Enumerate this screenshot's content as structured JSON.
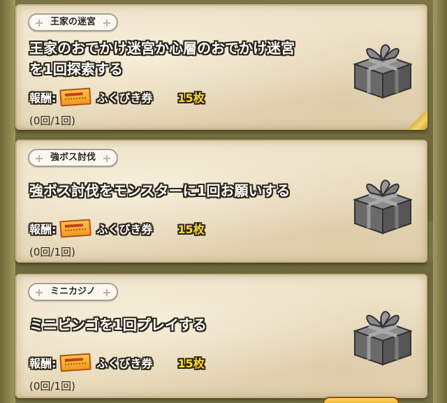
{
  "missions": [
    {
      "tag": "王家の迷宮",
      "title_line1": "王家のおでかけ迷宮か心層のおでかけ迷宮",
      "title_line2": "を1回探索する",
      "reward_label": "報酬:",
      "reward_icon": "ticket-icon",
      "reward_name": "ふくびき券",
      "reward_count": "15枚",
      "progress": "(0回/1回)",
      "status_icon": "gift-box-icon"
    },
    {
      "tag": "強ボス討伐",
      "title_line1": "強ボス討伐をモンスターに1回お願いする",
      "reward_label": "報酬:",
      "reward_icon": "ticket-icon",
      "reward_name": "ふくびき券",
      "reward_count": "15枚",
      "progress": "(0回/1回)",
      "status_icon": "gift-box-icon"
    },
    {
      "tag": "ミニカジノ",
      "title_line1": "ミニビンゴを1回プレイする",
      "reward_label": "報酬:",
      "reward_icon": "ticket-icon",
      "reward_name": "ふくびき券",
      "reward_count": "15枚",
      "progress": "(0回/1回)",
      "status_icon": "gift-box-icon"
    }
  ],
  "colors": {
    "parchment": "#ede1c6",
    "outline_text": "#2b2418",
    "reward_count": "#ffd92e",
    "background": "#6f6a3c"
  }
}
